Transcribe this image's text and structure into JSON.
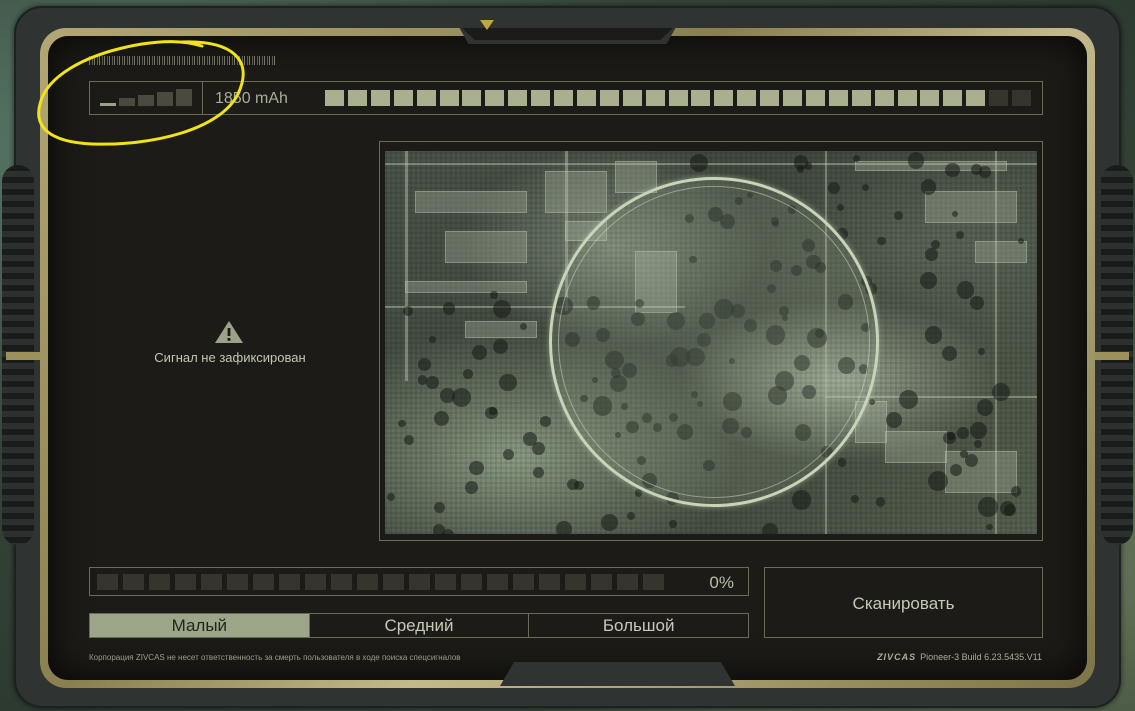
{
  "status": {
    "signal_level": 1,
    "signal_bars": 5,
    "battery_text": "1850 mAh",
    "battery_cells_total": 31,
    "battery_cells_on": 29
  },
  "signal_panel": {
    "icon": "warning-icon",
    "message": "Сигнал не зафиксирован"
  },
  "progress": {
    "cells_total": 22,
    "cells_on": 0,
    "value_text": "0%"
  },
  "size_tabs": [
    {
      "label": "Малый",
      "active": true
    },
    {
      "label": "Средний",
      "active": false
    },
    {
      "label": "Большой",
      "active": false
    }
  ],
  "scan_button": {
    "label": "Сканировать"
  },
  "footer": {
    "disclaimer": "Корпорация ZIVCAS не несет ответственность за смерть пользователя в ходе поиска спецсигналов",
    "brand": "ZIVCAS",
    "build": "Pioneer-3 Build 6.23.5435.V11"
  },
  "colors": {
    "accent_gold": "#b3a874",
    "screen_bg": "#1c1b17",
    "lcd_green": "#a8b090",
    "annotation_yellow": "#f2e21a"
  }
}
